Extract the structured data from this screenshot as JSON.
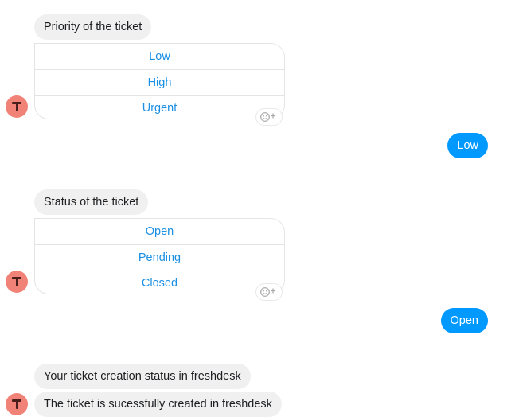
{
  "conversation": {
    "priority": {
      "question": "Priority of the ticket",
      "options": [
        "Low",
        "High",
        "Urgent"
      ],
      "reply": "Low"
    },
    "status": {
      "question": "Status of the ticket",
      "options": [
        "Open",
        "Pending",
        "Closed"
      ],
      "reply": "Open"
    },
    "result": {
      "line1": "Your ticket creation status in freshdesk",
      "line2": "The ticket is sucessfully created in freshdesk"
    },
    "bot_avatar_letter": "T",
    "react_icon": "smiley-plus-icon",
    "colors": {
      "user_bubble": "#0099ff",
      "bot_bubble": "#f1f0f0",
      "quick_reply_text": "#1a8fe3",
      "avatar_bg": "#f08277"
    }
  }
}
